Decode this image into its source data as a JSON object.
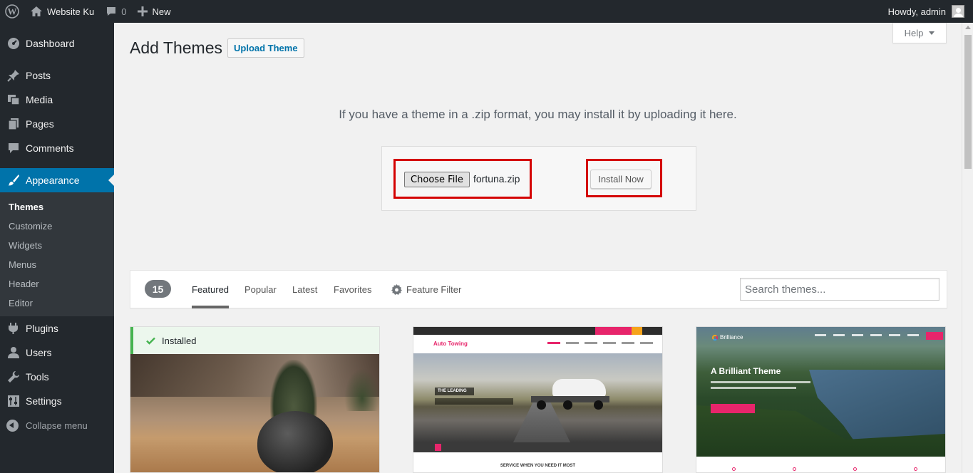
{
  "adminbar": {
    "site_name": "Website Ku",
    "comments_count": "0",
    "new_label": "New",
    "howdy": "Howdy, admin"
  },
  "sidebar": {
    "items": [
      {
        "label": "Dashboard",
        "icon": "dashboard-icon"
      },
      {
        "label": "Posts",
        "icon": "pin-icon"
      },
      {
        "label": "Media",
        "icon": "media-icon"
      },
      {
        "label": "Pages",
        "icon": "pages-icon"
      },
      {
        "label": "Comments",
        "icon": "comments-icon"
      },
      {
        "label": "Appearance",
        "icon": "brush-icon"
      },
      {
        "label": "Plugins",
        "icon": "plugin-icon"
      },
      {
        "label": "Users",
        "icon": "users-icon"
      },
      {
        "label": "Tools",
        "icon": "wrench-icon"
      },
      {
        "label": "Settings",
        "icon": "settings-icon"
      }
    ],
    "submenu": [
      "Themes",
      "Customize",
      "Widgets",
      "Menus",
      "Header",
      "Editor"
    ],
    "collapse_label": "Collapse menu"
  },
  "main": {
    "help_label": "Help",
    "title": "Add Themes",
    "upload_theme_label": "Upload Theme",
    "upload_desc": "If you have a theme in a .zip format, you may install it by uploading it here.",
    "choose_file_label": "Choose File",
    "file_name": "fortuna.zip",
    "install_now_label": "Install Now"
  },
  "filter": {
    "count": "15",
    "tabs": [
      "Featured",
      "Popular",
      "Latest",
      "Favorites"
    ],
    "feature_filter_label": "Feature Filter",
    "search_placeholder": "Search themes..."
  },
  "themes": {
    "installed_label": "Installed",
    "card2_logo": "Auto Towing",
    "card2_tag": "THE LEADING",
    "card2_footer": "SERVICE WHEN YOU NEED IT MOST",
    "card3_logo": "Brilliance",
    "card3_title": "A Brilliant Theme"
  },
  "colors": {
    "accent": "#0073aa",
    "highlight_red": "#d40000",
    "installed_green": "#46b450",
    "admin_dark": "#23282d"
  }
}
